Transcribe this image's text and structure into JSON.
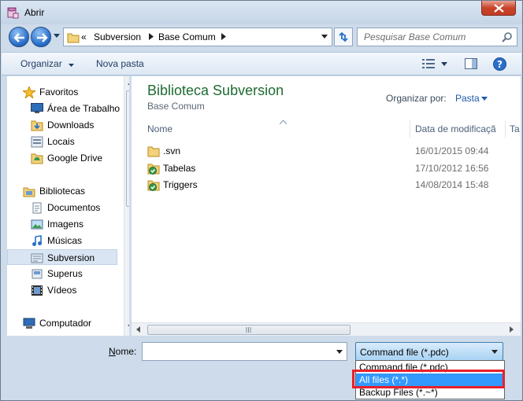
{
  "window": {
    "title": "Abrir",
    "close_icon": "close-icon"
  },
  "nav": {
    "breadcrumb_prefix": "«",
    "breadcrumb": [
      "Subversion",
      "Base Comum"
    ],
    "search_placeholder": "Pesquisar Base Comum"
  },
  "toolbar": {
    "organize": "Organizar",
    "new_folder": "Nova pasta"
  },
  "sidebar": {
    "favorites": {
      "label": "Favoritos",
      "items": [
        "Área de Trabalho",
        "Downloads",
        "Locais",
        "Google Drive"
      ]
    },
    "libraries": {
      "label": "Bibliotecas",
      "items": [
        "Documentos",
        "Imagens",
        "Músicas",
        "Subversion",
        "Superus",
        "Vídeos"
      ]
    },
    "computer": {
      "label": "Computador"
    },
    "selected": "Subversion"
  },
  "main": {
    "title": "Biblioteca Subversion",
    "subtitle": "Base Comum",
    "arrange_label": "Organizar por:",
    "arrange_value": "Pasta",
    "columns": {
      "name": "Nome",
      "date": "Data de modificaçã",
      "type": "Ta"
    },
    "files": [
      {
        "name": ".svn",
        "date": "16/01/2015 09:44",
        "icon": "folder-icon"
      },
      {
        "name": "Tabelas",
        "date": "17/10/2012 16:56",
        "icon": "svn-folder-icon"
      },
      {
        "name": "Triggers",
        "date": "14/08/2014 15:48",
        "icon": "svn-folder-icon"
      }
    ]
  },
  "footer": {
    "name_label_accel": "N",
    "name_label_rest": "ome:",
    "name_value": "",
    "file_type_selected": "Command file (*.pdc)",
    "file_type_options": [
      "Command file (*.pdc)",
      "All files (*.*)",
      "Backup Files (*.~*)"
    ],
    "highlighted_option": "All files (*.*)"
  },
  "colors": {
    "library_title": "#1e6b32",
    "highlight": "#3399ff",
    "annotation_box": "#e8202a"
  }
}
